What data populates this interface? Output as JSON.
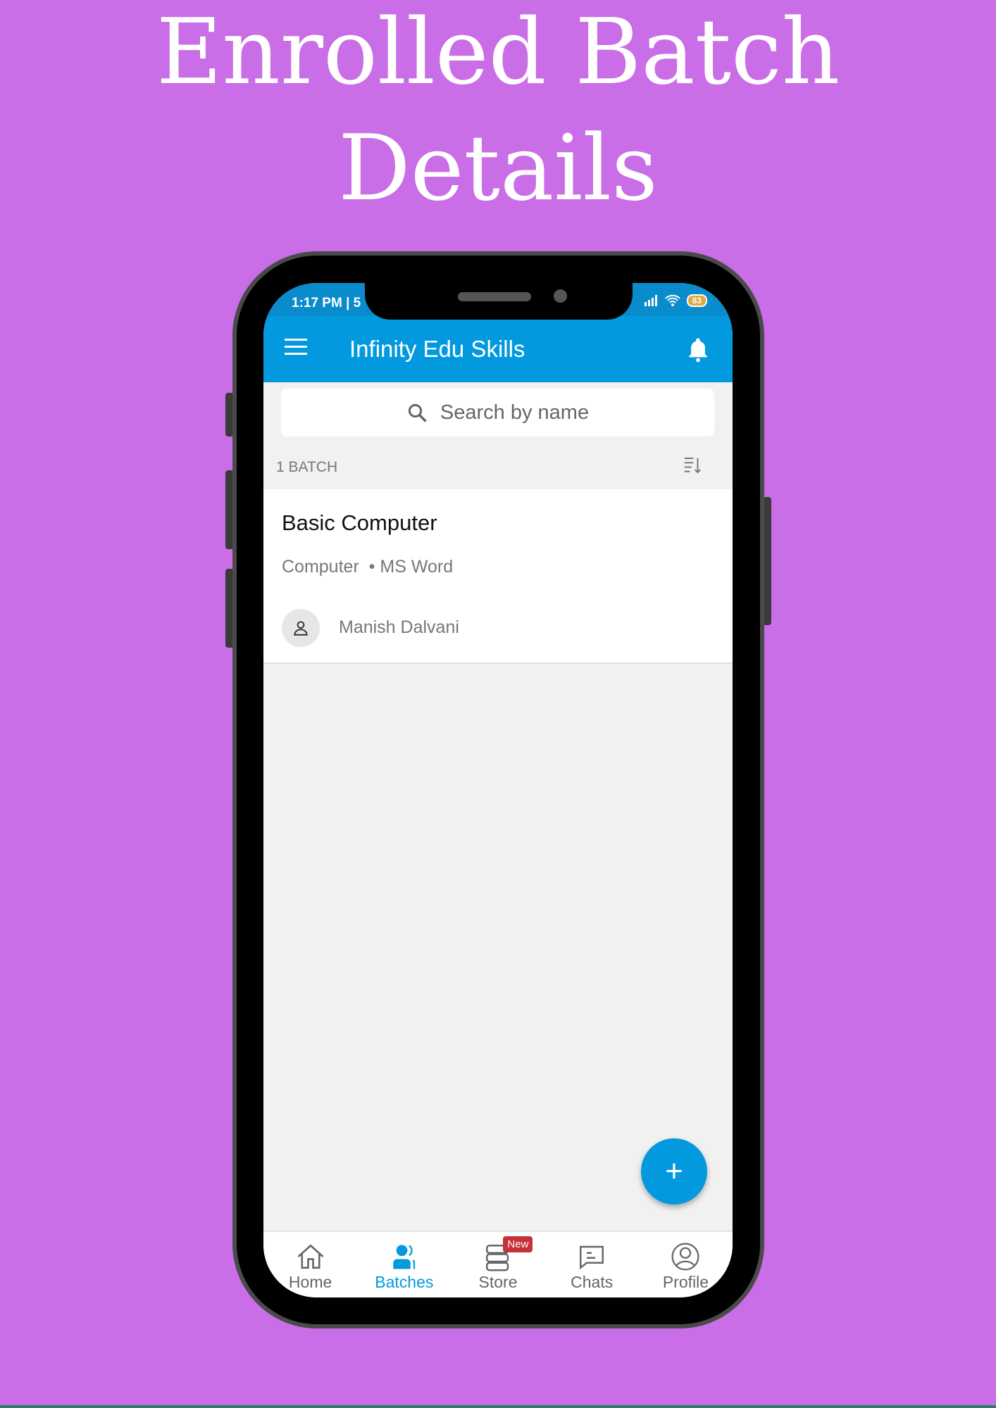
{
  "headline": {
    "line1": "Enrolled Batch",
    "line2": "Details"
  },
  "status_bar": {
    "time": "1:17 PM | 5",
    "battery": "83"
  },
  "app_bar": {
    "title": "Infinity Edu Skills",
    "menu_icon": "hamburger-icon",
    "bell_icon": "bell-icon"
  },
  "search": {
    "placeholder": "Search by name"
  },
  "list": {
    "count_label": "1 BATCH"
  },
  "batches": [
    {
      "name": "Basic Computer",
      "category": "Computer",
      "subject": "• MS Word",
      "teacher": "Manish Dalvani"
    }
  ],
  "fab": {
    "label": "+"
  },
  "bottom_nav": [
    {
      "label": "Home"
    },
    {
      "label": "Batches",
      "active": true
    },
    {
      "label": "Store",
      "badge": "New"
    },
    {
      "label": "Chats"
    },
    {
      "label": "Profile"
    }
  ],
  "colors": {
    "background": "#c96ee7",
    "primary": "#0299df",
    "badge": "#c6313a"
  }
}
